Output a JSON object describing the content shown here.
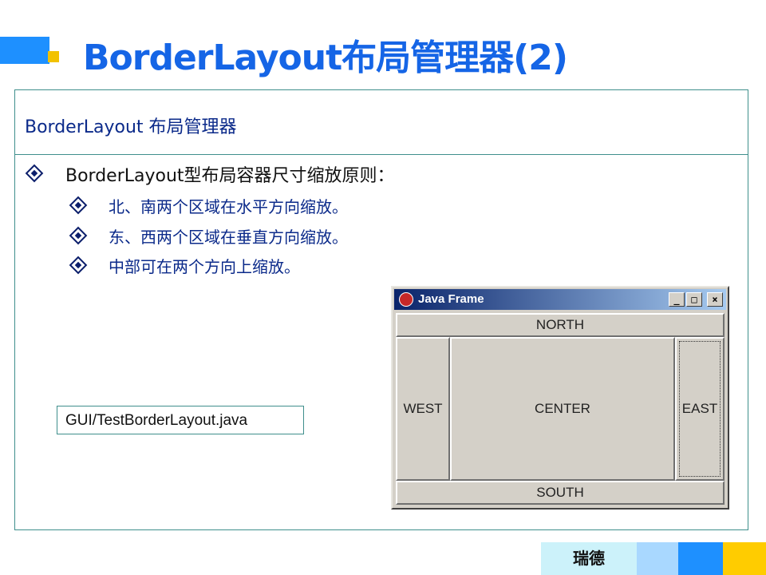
{
  "slide": {
    "title": "BorderLayout布局管理器(2)",
    "panel_heading": "BorderLayout 布局管理器",
    "bullet_main": "BorderLayout型布局容器尺寸缩放原则：",
    "sub_bullets": [
      "北、南两个区域在水平方向缩放。",
      "东、西两个区域在垂直方向缩放。",
      "中部可在两个方向上缩放。"
    ],
    "file_label": "GUI/TestBorderLayout.java"
  },
  "java_frame": {
    "title": "Java Frame",
    "minimize": "_",
    "maximize": "□",
    "close": "×",
    "regions": {
      "north": "NORTH",
      "west": "WEST",
      "center": "CENTER",
      "east": "EAST",
      "south": "SOUTH"
    }
  },
  "footer": {
    "brand": "瑞德"
  },
  "colors": {
    "title": "#1565e6",
    "accent_blue": "#1e90ff",
    "accent_yellow": "#f2c200",
    "panel_border": "#3f8f8c",
    "bullet_text": "#0b2a8a",
    "footer_cells": [
      "#ccf2fa",
      "#a9d8ff",
      "#1e90ff",
      "#ffcc00"
    ]
  },
  "icons": [
    "diamond-bullet-icon",
    "java-cup-icon"
  ]
}
